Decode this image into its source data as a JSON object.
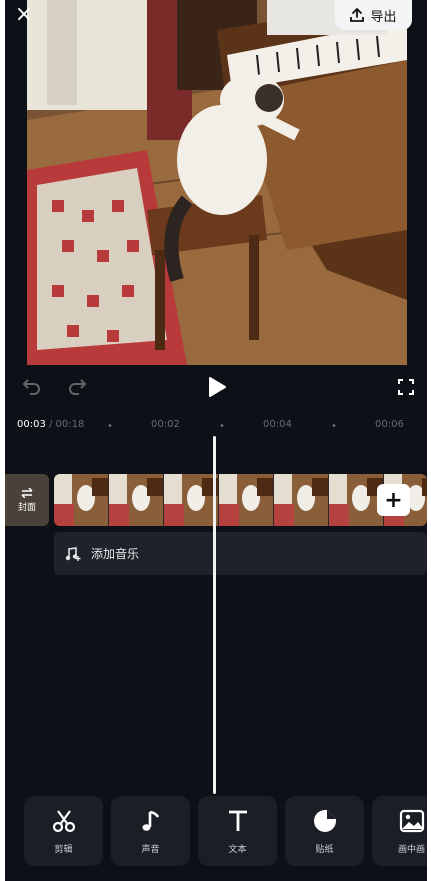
{
  "header": {
    "close_icon": "×",
    "export_label": "导出"
  },
  "player": {
    "current_time": "00:03",
    "total_time": " / 00:18",
    "ticks": [
      "00:02",
      "00:04",
      "00:06"
    ]
  },
  "timeline": {
    "cover_label": "封面",
    "add_clip_label": "+",
    "add_music_label": "添加音乐"
  },
  "toolbar": {
    "items": [
      {
        "label": "剪辑",
        "icon": "scissors-icon"
      },
      {
        "label": "声音",
        "icon": "music-note-icon"
      },
      {
        "label": "文本",
        "icon": "text-icon"
      },
      {
        "label": "贴纸",
        "icon": "sticker-icon"
      },
      {
        "label": "画中画",
        "icon": "picture-in-picture-icon"
      }
    ]
  },
  "colors": {
    "background": "#0d1117",
    "panel": "#1e232b",
    "tool_bg": "#1a1f26"
  }
}
